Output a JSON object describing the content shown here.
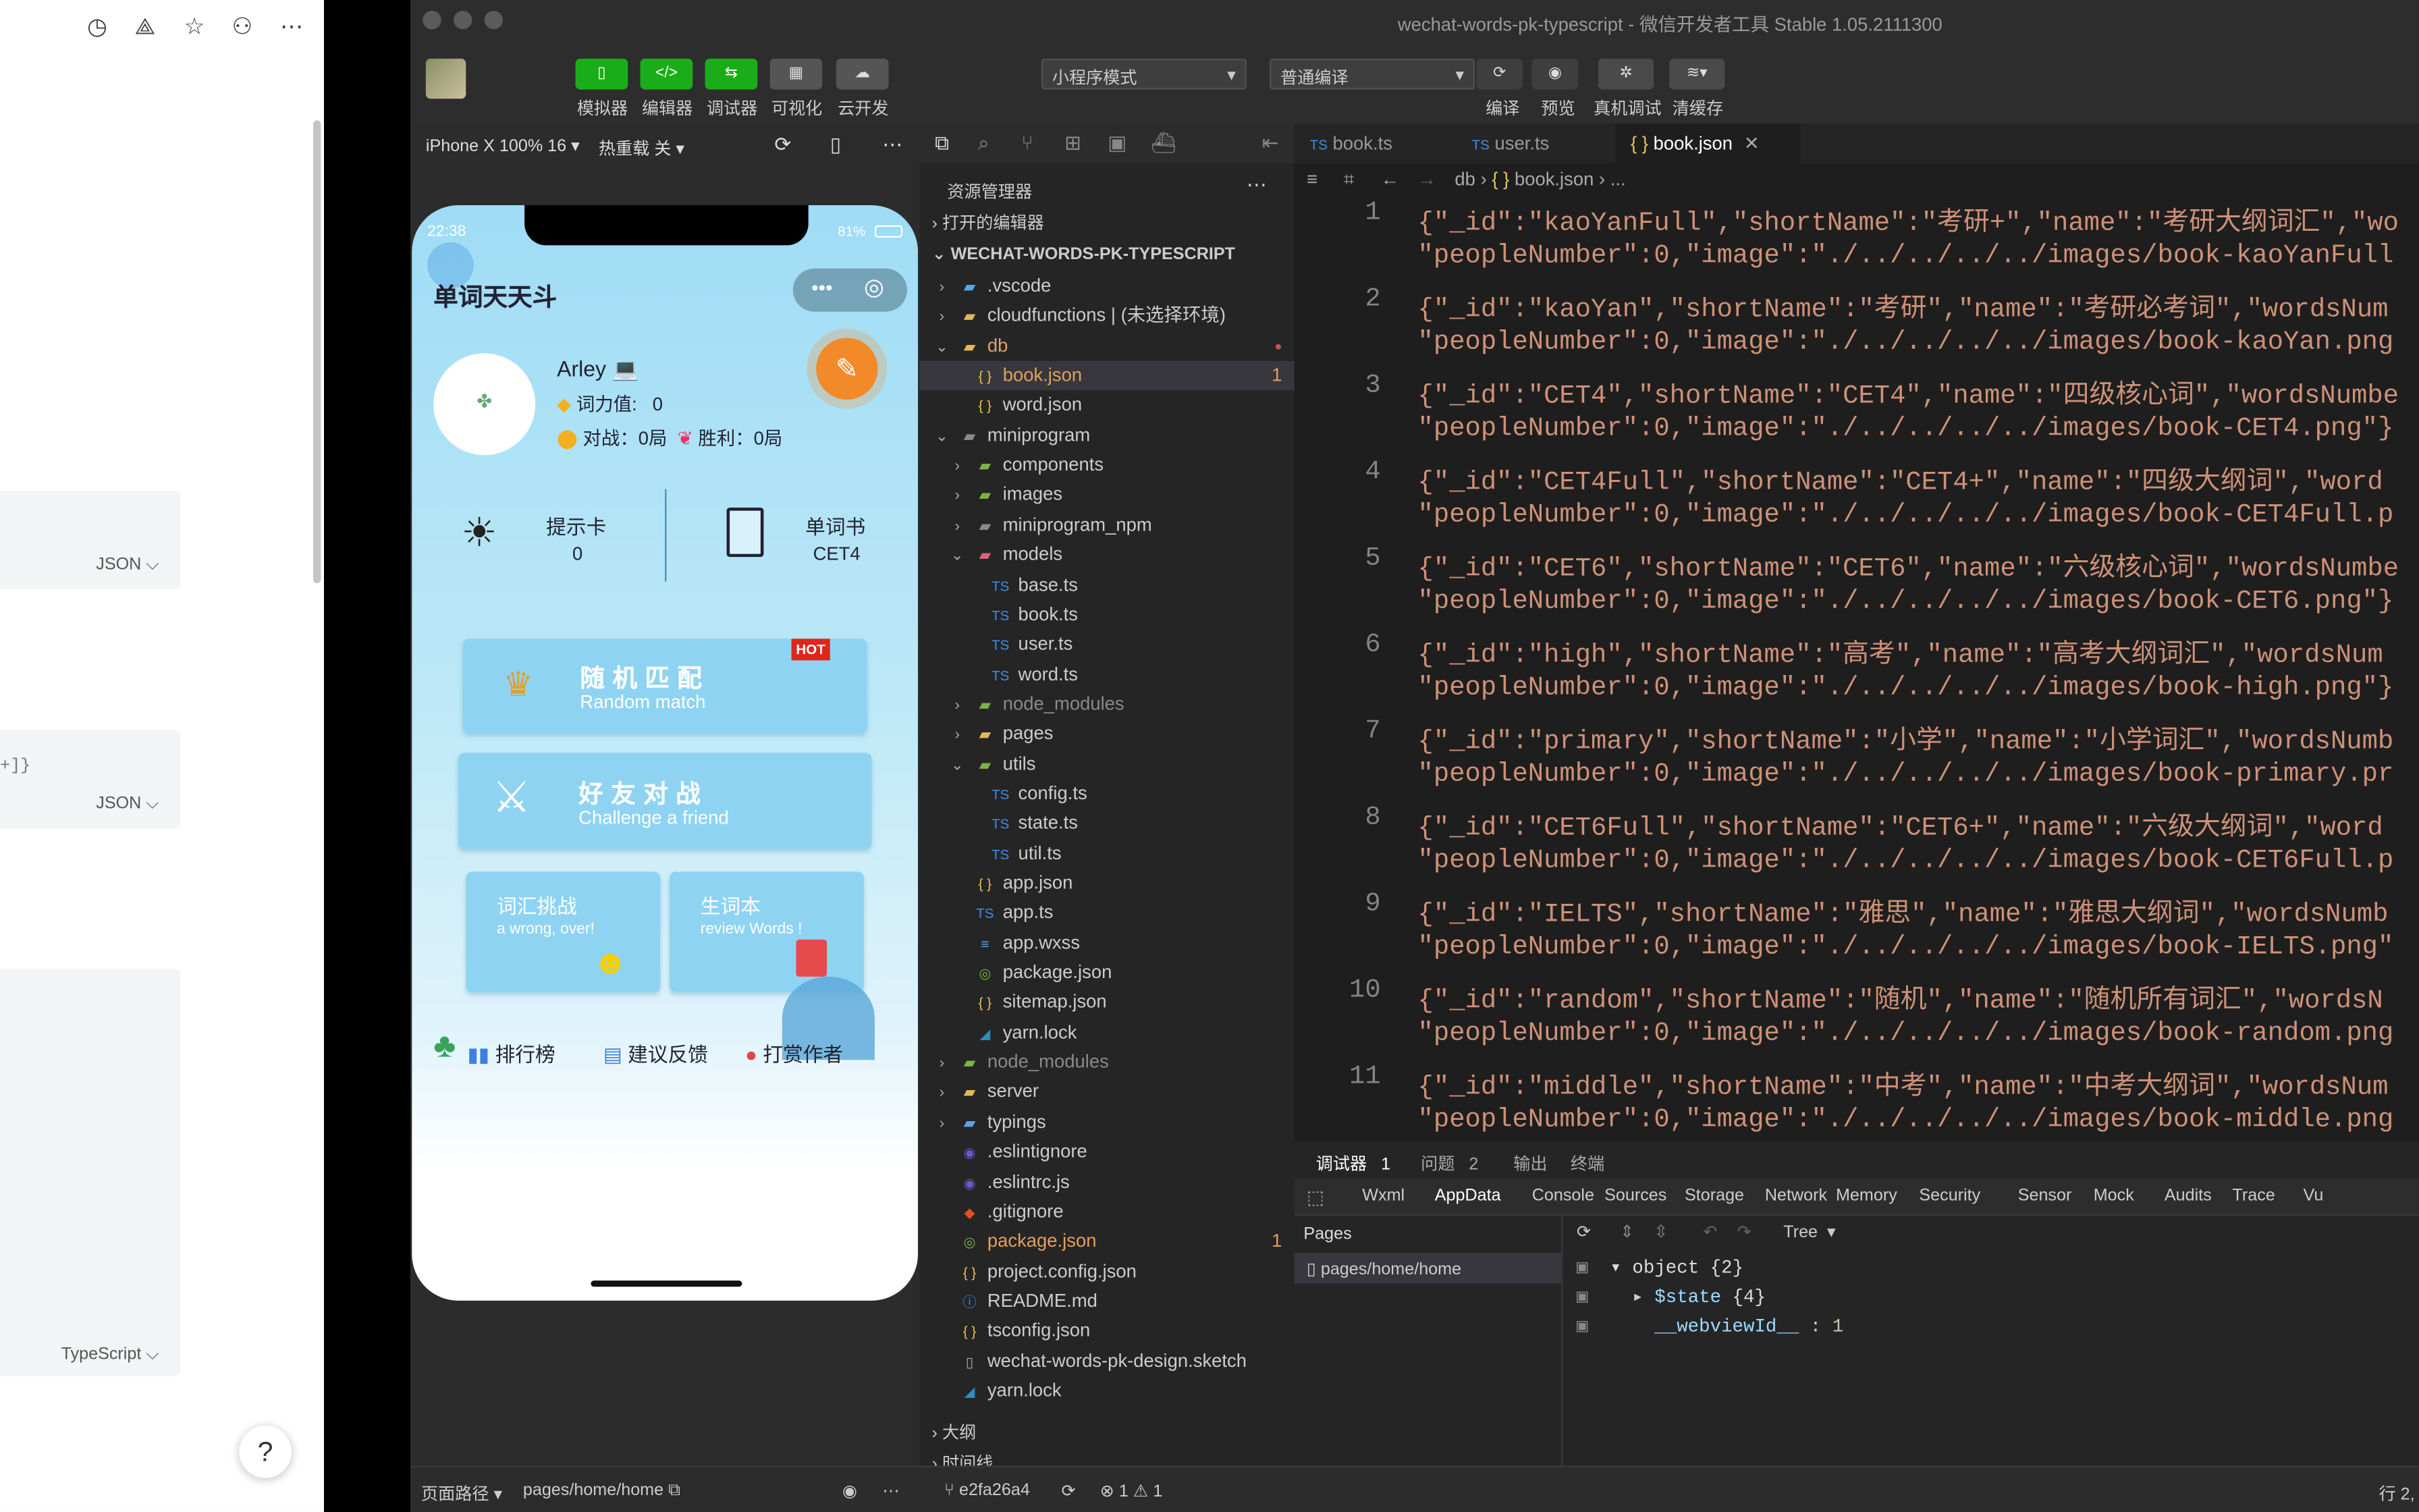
{
  "left_panel": {
    "cards": [
      {
        "lang": "JSON"
      },
      {
        "lang": "JSON",
        "snippet": "+]}"
      },
      {
        "lang": "TypeScript"
      }
    ],
    "help": "?"
  },
  "window": {
    "title": "wechat-words-pk-typescript - 微信开发者工具 Stable 1.05.2111300"
  },
  "toolbar": {
    "buttons": [
      {
        "label": "模拟器",
        "glyph": "▯"
      },
      {
        "label": "编辑器",
        "glyph": "</>"
      },
      {
        "label": "调试器",
        "glyph": "⇆"
      },
      {
        "label": "可视化",
        "glyph": "▦"
      },
      {
        "label": "云开发",
        "glyph": "☁"
      }
    ],
    "mode_select": "小程序模式",
    "compile_select": "普通编译",
    "right_buttons": [
      {
        "label": "编译"
      },
      {
        "label": "预览"
      },
      {
        "label": "真机调试"
      },
      {
        "label": "清缓存"
      }
    ]
  },
  "simulator": {
    "device": "iPhone X 100% 16",
    "hotreload": "热重载 关",
    "phone": {
      "time": "22:38",
      "battery": "81%",
      "app_title": "单词天天斗",
      "user": {
        "name": "Arley 💻",
        "power_label": "词力值:",
        "power": "0",
        "battles": "对战：0局",
        "wins": "胜利：0局"
      },
      "hint_card": {
        "label": "提示卡",
        "value": "0"
      },
      "book_card": {
        "label": "单词书",
        "value": "CET4"
      },
      "random": {
        "title": "随机匹配",
        "subtitle": "Random match",
        "badge": "HOT"
      },
      "friend": {
        "title": "好友对战",
        "subtitle": "Challenge a friend"
      },
      "vocab": {
        "title": "词汇挑战",
        "subtitle": "a wrong, over!"
      },
      "newwords": {
        "title": "生词本",
        "subtitle": "review Words !"
      },
      "nav": [
        "排行榜",
        "建议反馈",
        "打赏作者"
      ]
    }
  },
  "explorer": {
    "header": "资源管理器",
    "open_editors": "打开的编辑器",
    "project": "WECHAT-WORDS-PK-TYPESCRIPT",
    "tree": [
      {
        "name": ".vscode",
        "level": 1,
        "type": "folder",
        "color": "#5aa5e6"
      },
      {
        "name": "cloudfunctions | (未选择环境)",
        "level": 1,
        "type": "folder",
        "color": "#e8b65a"
      },
      {
        "name": "db",
        "level": 1,
        "type": "folder-open",
        "color": "#e8b65a",
        "modified": true
      },
      {
        "name": "book.json",
        "level": 2,
        "type": "json",
        "modified": true,
        "badge": "1",
        "selected": true
      },
      {
        "name": "word.json",
        "level": 2,
        "type": "json"
      },
      {
        "name": "miniprogram",
        "level": 1,
        "type": "folder-open",
        "color": "#8a8a8a"
      },
      {
        "name": "components",
        "level": 2,
        "type": "folder",
        "color": "#7cb342"
      },
      {
        "name": "images",
        "level": 2,
        "type": "folder",
        "color": "#7cb342"
      },
      {
        "name": "miniprogram_npm",
        "level": 2,
        "type": "folder",
        "color": "#8a8a8a"
      },
      {
        "name": "models",
        "level": 2,
        "type": "folder-open",
        "color": "#e0607e"
      },
      {
        "name": "base.ts",
        "level": 3,
        "type": "ts"
      },
      {
        "name": "book.ts",
        "level": 3,
        "type": "ts"
      },
      {
        "name": "user.ts",
        "level": 3,
        "type": "ts"
      },
      {
        "name": "word.ts",
        "level": 3,
        "type": "ts"
      },
      {
        "name": "node_modules",
        "level": 2,
        "type": "folder",
        "color": "#7cb342",
        "dim": true
      },
      {
        "name": "pages",
        "level": 2,
        "type": "folder",
        "color": "#e8b65a"
      },
      {
        "name": "utils",
        "level": 2,
        "type": "folder-open",
        "color": "#7cb342"
      },
      {
        "name": "config.ts",
        "level": 3,
        "type": "ts"
      },
      {
        "name": "state.ts",
        "level": 3,
        "type": "ts"
      },
      {
        "name": "util.ts",
        "level": 3,
        "type": "ts"
      },
      {
        "name": "app.json",
        "level": 2,
        "type": "json"
      },
      {
        "name": "app.ts",
        "level": 2,
        "type": "ts"
      },
      {
        "name": "app.wxss",
        "level": 2,
        "type": "css"
      },
      {
        "name": "package.json",
        "level": 2,
        "type": "npm"
      },
      {
        "name": "sitemap.json",
        "level": 2,
        "type": "json"
      },
      {
        "name": "yarn.lock",
        "level": 2,
        "type": "yarn"
      },
      {
        "name": "node_modules",
        "level": 1,
        "type": "folder",
        "color": "#7cb342",
        "dim": true
      },
      {
        "name": "server",
        "level": 1,
        "type": "folder",
        "color": "#e8b65a"
      },
      {
        "name": "typings",
        "level": 1,
        "type": "folder",
        "color": "#5aa5e6"
      },
      {
        "name": ".eslintignore",
        "level": 1,
        "type": "eslint"
      },
      {
        "name": ".eslintrc.js",
        "level": 1,
        "type": "eslint"
      },
      {
        "name": ".gitignore",
        "level": 1,
        "type": "git"
      },
      {
        "name": "package.json",
        "level": 1,
        "type": "npm",
        "modified": true,
        "badge": "1"
      },
      {
        "name": "project.config.json",
        "level": 1,
        "type": "json"
      },
      {
        "name": "README.md",
        "level": 1,
        "type": "info"
      },
      {
        "name": "tsconfig.json",
        "level": 1,
        "type": "json"
      },
      {
        "name": "wechat-words-pk-design.sketch",
        "level": 1,
        "type": "file"
      },
      {
        "name": "yarn.lock",
        "level": 1,
        "type": "yarn"
      }
    ],
    "outline": "大纲",
    "timeline": "时间线"
  },
  "editor": {
    "tabs": [
      {
        "label": "book.ts",
        "type": "ts"
      },
      {
        "label": "user.ts",
        "type": "ts"
      },
      {
        "label": "book.json",
        "type": "json",
        "active": true
      }
    ],
    "breadcrumb": [
      "db",
      "book.json",
      "..."
    ],
    "lines": [
      {
        "n": "1",
        "a": "{\"_id\":\"kaoYanFull\",\"shortName\":\"考研+\",\"name\":\"考研大纲词汇\",\"wo",
        "b": "\"peopleNumber\":0,\"image\":\"./../../../../images/book-kaoYanFull"
      },
      {
        "n": "2",
        "a": "{\"_id\":\"kaoYan\",\"shortName\":\"考研\",\"name\":\"考研必考词\",\"wordsNum",
        "b": "\"peopleNumber\":0,\"image\":\"./../../../../images/book-kaoYan.png"
      },
      {
        "n": "3",
        "a": "{\"_id\":\"CET4\",\"shortName\":\"CET4\",\"name\":\"四级核心词\",\"wordsNumbe",
        "b": "\"peopleNumber\":0,\"image\":\"./../../../../images/book-CET4.png\"}"
      },
      {
        "n": "4",
        "a": "{\"_id\":\"CET4Full\",\"shortName\":\"CET4+\",\"name\":\"四级大纲词\",\"word",
        "b": "\"peopleNumber\":0,\"image\":\"./../../../../images/book-CET4Full.p"
      },
      {
        "n": "5",
        "a": "{\"_id\":\"CET6\",\"shortName\":\"CET6\",\"name\":\"六级核心词\",\"wordsNumbe",
        "b": "\"peopleNumber\":0,\"image\":\"./../../../../images/book-CET6.png\"}"
      },
      {
        "n": "6",
        "a": "{\"_id\":\"high\",\"shortName\":\"高考\",\"name\":\"高考大纲词汇\",\"wordsNum",
        "b": "\"peopleNumber\":0,\"image\":\"./../../../../images/book-high.png\"}"
      },
      {
        "n": "7",
        "a": "{\"_id\":\"primary\",\"shortName\":\"小学\",\"name\":\"小学词汇\",\"wordsNumb",
        "b": "\"peopleNumber\":0,\"image\":\"./../../../../images/book-primary.pr"
      },
      {
        "n": "8",
        "a": "{\"_id\":\"CET6Full\",\"shortName\":\"CET6+\",\"name\":\"六级大纲词\",\"word",
        "b": "\"peopleNumber\":0,\"image\":\"./../../../../images/book-CET6Full.p"
      },
      {
        "n": "9",
        "a": "{\"_id\":\"IELTS\",\"shortName\":\"雅思\",\"name\":\"雅思大纲词\",\"wordsNumb",
        "b": "\"peopleNumber\":0,\"image\":\"./../../../../images/book-IELTS.png\""
      },
      {
        "n": "10",
        "a": "{\"_id\":\"random\",\"shortName\":\"随机\",\"name\":\"随机所有词汇\",\"wordsN",
        "b": "\"peopleNumber\":0,\"image\":\"./../../../../images/book-random.png"
      },
      {
        "n": "11",
        "a": "{\"_id\":\"middle\",\"shortName\":\"中考\",\"name\":\"中考大纲词\",\"wordsNum",
        "b": "\"peopleNumber\":0,\"image\":\"./../../../../images/book-middle.png"
      }
    ]
  },
  "debugger": {
    "top_tabs": [
      {
        "label": "调试器",
        "count": "1"
      },
      {
        "label": "问题",
        "count": "2"
      },
      {
        "label": "输出"
      },
      {
        "label": "终端"
      }
    ],
    "panel_tabs": [
      "Wxml",
      "AppData",
      "Console",
      "Sources",
      "Storage",
      "Network",
      "Memory",
      "Security",
      "Sensor",
      "Mock",
      "Audits",
      "Trace",
      "Vu"
    ],
    "active_tab": "AppData",
    "pages_header": "Pages",
    "page": "pages/home/home",
    "view_mode": "Tree",
    "tree": [
      {
        "key": "object",
        "val": "{2}"
      },
      {
        "key": "$state",
        "val": "{4}"
      },
      {
        "key": "__webviewId__",
        "val": "1"
      }
    ]
  },
  "statusbar": {
    "path_label": "页面路径",
    "path": "pages/home/home",
    "commit": "e2fa26a4",
    "errors": "1",
    "warnings": "1",
    "position": "行 2,"
  }
}
